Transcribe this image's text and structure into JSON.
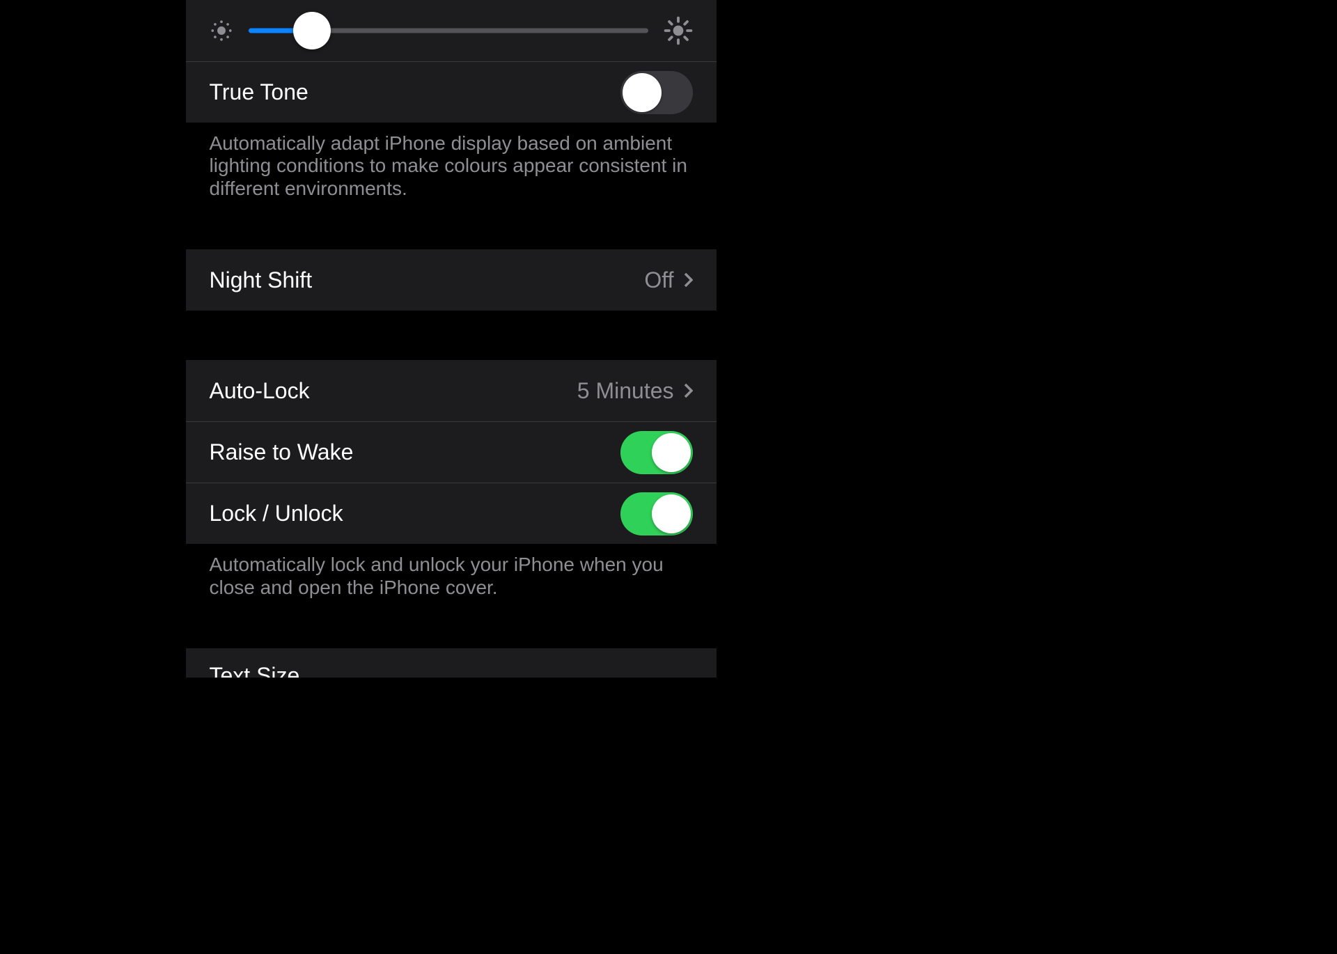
{
  "brightness": {
    "percent": 16
  },
  "trueTone": {
    "label": "True Tone",
    "on": false,
    "description": "Automatically adapt iPhone display based on ambient lighting conditions to make colours appear consistent in different environments."
  },
  "nightShift": {
    "label": "Night Shift",
    "value": "Off"
  },
  "autoLock": {
    "label": "Auto-Lock",
    "value": "5 Minutes"
  },
  "raiseToWake": {
    "label": "Raise to Wake",
    "on": true
  },
  "lockUnlock": {
    "label": "Lock / Unlock",
    "on": true,
    "description": "Automatically lock and unlock your iPhone when you close and open the iPhone cover."
  },
  "textSize": {
    "label": "Text Size"
  }
}
